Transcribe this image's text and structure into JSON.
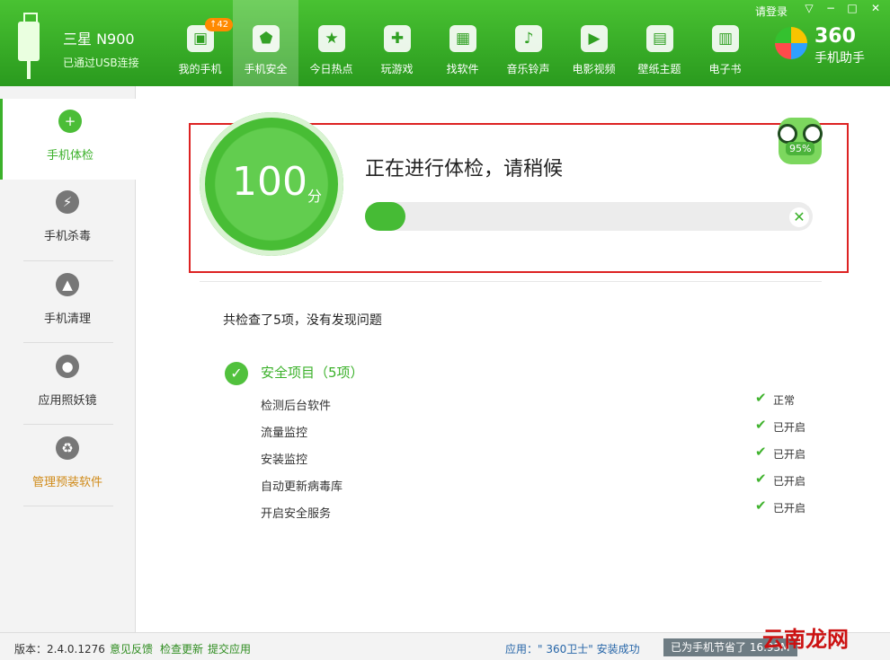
{
  "device": {
    "name": "三星 N900",
    "status": "已通过USB连接"
  },
  "top_right": {
    "login": "请登录"
  },
  "nav": [
    {
      "label": "我的手机",
      "badge": "↑42"
    },
    {
      "label": "手机安全"
    },
    {
      "label": "今日热点"
    },
    {
      "label": "玩游戏"
    },
    {
      "label": "找软件"
    },
    {
      "label": "音乐铃声"
    },
    {
      "label": "电影视频"
    },
    {
      "label": "壁纸主题"
    },
    {
      "label": "电子书"
    }
  ],
  "brand": {
    "number": "360",
    "subtitle": "手机助手"
  },
  "sidebar": [
    {
      "label": "手机体检"
    },
    {
      "label": "手机杀毒"
    },
    {
      "label": "手机清理"
    },
    {
      "label": "应用照妖镜"
    },
    {
      "label": "管理预装软件"
    }
  ],
  "scan": {
    "score": "100",
    "unit": "分",
    "title": "正在进行体检，请稍候",
    "progress": 0.09,
    "mascot_percent": "95%"
  },
  "summary": "共检查了5项，没有发现问题",
  "group": {
    "title": "安全项目（5项）",
    "items": [
      {
        "name": "检测后台软件",
        "status": "正常"
      },
      {
        "name": "流量监控",
        "status": "已开启"
      },
      {
        "name": "安装监控",
        "status": "已开启"
      },
      {
        "name": "自动更新病毒库",
        "status": "已开启"
      },
      {
        "name": "开启安全服务",
        "status": "已开启"
      }
    ]
  },
  "footer": {
    "version": "版本：2.4.0.1276",
    "feedback": "意见反馈",
    "check_update": "检查更新",
    "submit": "提交应用",
    "install": "应用：\" 360卫士\" 安装成功",
    "saved": "已为手机节省了 16.93M"
  },
  "watermark": "云南龙网"
}
